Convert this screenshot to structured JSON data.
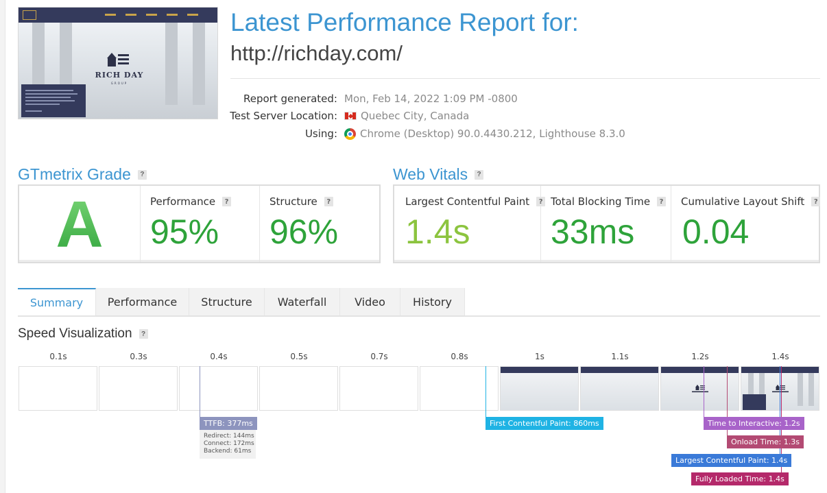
{
  "header": {
    "title": "Latest Performance Report for:",
    "url": "http://richday.com/",
    "thumbnail": {
      "brand": "RICH DAY",
      "brand_sub": "GROUP"
    },
    "meta": [
      {
        "key": "Report generated:",
        "value": "Mon, Feb 14, 2022 1:09 PM -0800",
        "icon": "none"
      },
      {
        "key": "Test Server Location:",
        "value": "Quebec City, Canada",
        "icon": "canada-flag-icon"
      },
      {
        "key": "Using:",
        "value": "Chrome (Desktop) 90.0.4430.212, Lighthouse 8.3.0",
        "icon": "chrome-icon"
      }
    ]
  },
  "grade": {
    "title": "GTmetrix Grade",
    "letter": "A",
    "performance": {
      "label": "Performance",
      "value": "95%"
    },
    "structure": {
      "label": "Structure",
      "value": "96%"
    }
  },
  "vitals": {
    "title": "Web Vitals",
    "lcp": {
      "label": "Largest Contentful Paint",
      "value": "1.4s"
    },
    "tbt": {
      "label": "Total Blocking Time",
      "value": "33ms"
    },
    "cls": {
      "label": "Cumulative Layout Shift",
      "value": "0.04"
    }
  },
  "tabs": [
    "Summary",
    "Performance",
    "Structure",
    "Waterfall",
    "Video",
    "History"
  ],
  "active_tab": "Summary",
  "speed_viz": {
    "title": "Speed Visualization",
    "ticks": [
      "0.1s",
      "0.3s",
      "0.4s",
      "0.5s",
      "0.7s",
      "0.8s",
      "1s",
      "1.1s",
      "1.2s",
      "1.4s"
    ],
    "frames_state": [
      "blank",
      "blank",
      "blank",
      "blank",
      "blank",
      "blank",
      "header",
      "header",
      "logo",
      "full"
    ],
    "markers": {
      "ttfb": "TTFB: 377ms",
      "fcp": "First Contentful Paint: 860ms",
      "tti": "Time to Interactive: 1.2s",
      "onload": "Onload Time: 1.3s",
      "lcp": "Largest Contentful Paint: 1.4s",
      "fully_loaded": "Fully Loaded Time: 1.4s"
    },
    "ttfb_breakdown": {
      "redirect": "Redirect: 144ms",
      "connect": "Connect: 172ms",
      "backend": "Backend: 61ms"
    }
  },
  "colors": {
    "accent": "#3c95d1",
    "grade_green": "#2ea33a",
    "lcp_green": "#8cc43f",
    "ttfb": "#8d94be",
    "fcp": "#1fb3e4",
    "tti": "#a863c9",
    "onload": "#b34a73",
    "lcp_marker": "#3a7ad8",
    "fully_loaded": "#b4296a"
  }
}
